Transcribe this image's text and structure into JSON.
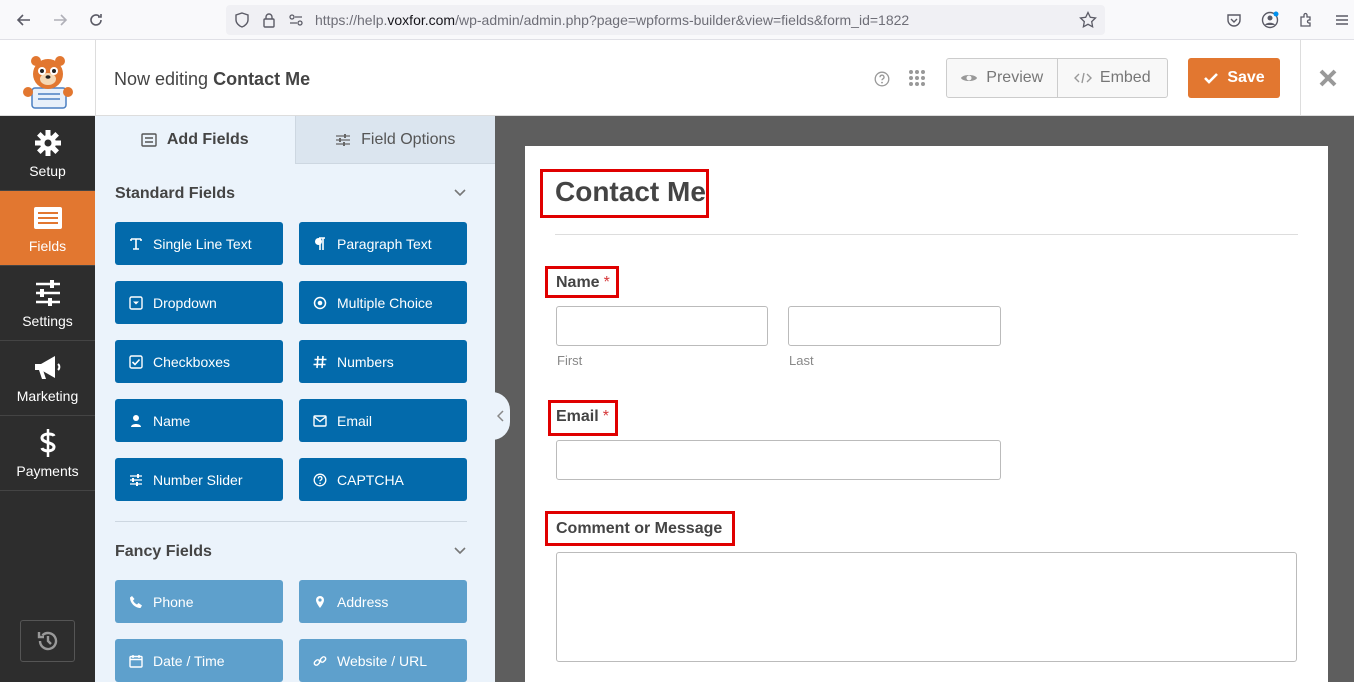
{
  "browser": {
    "url_prefix": "https://help.",
    "url_domain": "voxfor.com",
    "url_path": "/wp-admin/admin.php?page=wpforms-builder&view=fields&form_id=1822"
  },
  "header": {
    "editing_prefix": "Now editing",
    "form_name": "Contact Me",
    "preview_label": "Preview",
    "embed_label": "Embed",
    "save_label": "Save"
  },
  "nav": {
    "items": [
      {
        "label": "Setup",
        "icon": "gear-icon"
      },
      {
        "label": "Fields",
        "icon": "fields-icon"
      },
      {
        "label": "Settings",
        "icon": "sliders-icon"
      },
      {
        "label": "Marketing",
        "icon": "megaphone-icon"
      },
      {
        "label": "Payments",
        "icon": "dollar-icon"
      }
    ]
  },
  "panel": {
    "tab_add_fields": "Add Fields",
    "tab_field_options": "Field Options",
    "standard_title": "Standard Fields",
    "fancy_title": "Fancy Fields",
    "standard_fields": [
      "Single Line Text",
      "Paragraph Text",
      "Dropdown",
      "Multiple Choice",
      "Checkboxes",
      "Numbers",
      "Name",
      "Email",
      "Number Slider",
      "CAPTCHA"
    ],
    "fancy_fields": [
      "Phone",
      "Address",
      "Date / Time",
      "Website / URL"
    ]
  },
  "form": {
    "title": "Contact Me",
    "name_label": "Name",
    "required_mark": "*",
    "first_sublabel": "First",
    "last_sublabel": "Last",
    "email_label": "Email",
    "comment_label": "Comment or Message"
  },
  "colors": {
    "accent_orange": "#e27730",
    "field_button_blue": "#036aab",
    "fancy_button_blue": "#5ea0cc",
    "highlight_red": "#e00000"
  }
}
